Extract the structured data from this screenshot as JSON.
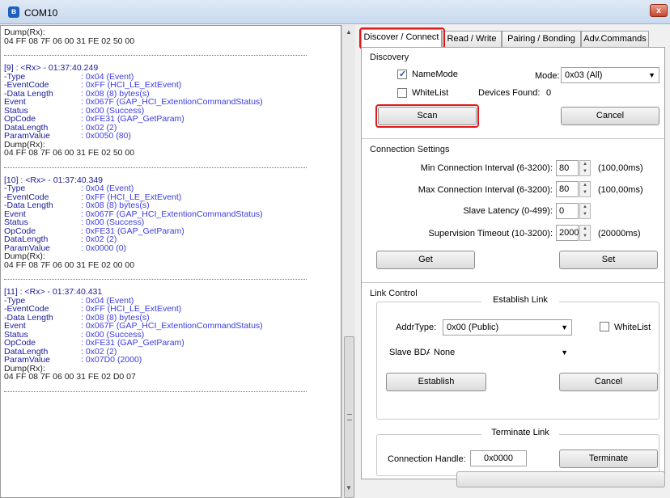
{
  "window": {
    "title": "COM10",
    "close_glyph": "x"
  },
  "log": {
    "top": {
      "dump_label": "Dump(Rx):",
      "dump_value": "04 FF 08 7F 06 00 31 FE 02 50 00"
    },
    "entries": [
      {
        "header": "[9] : <Rx> - 01:37:40.249",
        "fields": [
          {
            "key": "-Type",
            "value": ": 0x04 (Event)"
          },
          {
            "key": "-EventCode",
            "value": ": 0xFF (HCI_LE_ExtEvent)"
          },
          {
            "key": "-Data Length",
            "value": ": 0x08 (8) bytes(s)"
          },
          {
            "key": " Event",
            "value": ": 0x067F (GAP_HCI_ExtentionCommandStatus)"
          },
          {
            "key": " Status",
            "value": ": 0x00 (Success)"
          },
          {
            "key": " OpCode",
            "value": ": 0xFE31 (GAP_GetParam)"
          },
          {
            "key": " DataLength",
            "value": ": 0x02 (2)"
          },
          {
            "key": " ParamValue",
            "value": ": 0x0050 (80)"
          }
        ],
        "dump_label": "Dump(Rx):",
        "dump_value": "04 FF 08 7F 06 00 31 FE 02 50 00"
      },
      {
        "header": "[10] : <Rx> - 01:37:40.349",
        "fields": [
          {
            "key": "-Type",
            "value": ": 0x04 (Event)"
          },
          {
            "key": "-EventCode",
            "value": ": 0xFF (HCI_LE_ExtEvent)"
          },
          {
            "key": "-Data Length",
            "value": ": 0x08 (8) bytes(s)"
          },
          {
            "key": " Event",
            "value": ": 0x067F (GAP_HCI_ExtentionCommandStatus)"
          },
          {
            "key": " Status",
            "value": ": 0x00 (Success)"
          },
          {
            "key": " OpCode",
            "value": ": 0xFE31 (GAP_GetParam)"
          },
          {
            "key": " DataLength",
            "value": ": 0x02 (2)"
          },
          {
            "key": " ParamValue",
            "value": ": 0x0000 (0)"
          }
        ],
        "dump_label": "Dump(Rx):",
        "dump_value": "04 FF 08 7F 06 00 31 FE 02 00 00"
      },
      {
        "header": "[11] : <Rx> - 01:37:40.431",
        "fields": [
          {
            "key": "-Type",
            "value": ": 0x04 (Event)"
          },
          {
            "key": "-EventCode",
            "value": ": 0xFF (HCI_LE_ExtEvent)"
          },
          {
            "key": "-Data Length",
            "value": ": 0x08 (8) bytes(s)"
          },
          {
            "key": " Event",
            "value": ": 0x067F (GAP_HCI_ExtentionCommandStatus)"
          },
          {
            "key": " Status",
            "value": ": 0x00 (Success)"
          },
          {
            "key": " OpCode",
            "value": ": 0xFE31 (GAP_GetParam)"
          },
          {
            "key": " DataLength",
            "value": ": 0x02 (2)"
          },
          {
            "key": " ParamValue",
            "value": ": 0x07D0 (2000)"
          }
        ],
        "dump_label": "Dump(Rx):",
        "dump_value": "04 FF 08 7F 06 00 31 FE 02 D0 07"
      }
    ]
  },
  "tabs": [
    {
      "label": "Discover / Connect",
      "active": true
    },
    {
      "label": "Read / Write",
      "active": false
    },
    {
      "label": "Pairing / Bonding",
      "active": false
    },
    {
      "label": "Adv.Commands",
      "active": false
    }
  ],
  "discovery": {
    "title": "Discovery",
    "namemode_label": "NameMode",
    "namemode_checked": true,
    "mode_label": "Mode:",
    "mode_value": "0x03 (All)",
    "whitelist_label": "WhiteList",
    "whitelist_checked": false,
    "devices_found_label": "Devices Found:",
    "devices_found_value": "0",
    "scan_label": "Scan",
    "cancel_label": "Cancel"
  },
  "connection": {
    "title": "Connection Settings",
    "min_label": "Min Connection Interval (6-3200):",
    "min_value": "80",
    "min_ms": "(100,00ms)",
    "max_label": "Max Connection Interval (6-3200):",
    "max_value": "80",
    "max_ms": "(100,00ms)",
    "latency_label": "Slave Latency (0-499):",
    "latency_value": "0",
    "timeout_label": "Supervision Timeout (10-3200):",
    "timeout_value": "2000",
    "timeout_ms": "(20000ms)",
    "get_label": "Get",
    "set_label": "Set"
  },
  "link": {
    "title": "Link Control",
    "establish_title": "Establish Link",
    "addrtype_label": "AddrType:",
    "addrtype_value": "0x00 (Public)",
    "whitelist_label": "WhiteList",
    "slave_bda_label": "Slave BDA:",
    "slave_bda_value": "None",
    "establish_label": "Establish",
    "cancel_label": "Cancel",
    "terminate_title": "Terminate Link",
    "handle_label": "Connection Handle:",
    "handle_value": "0x0000",
    "terminate_label": "Terminate"
  },
  "colors": {
    "highlight": "#e01818",
    "log_text": "#3b3be0"
  }
}
